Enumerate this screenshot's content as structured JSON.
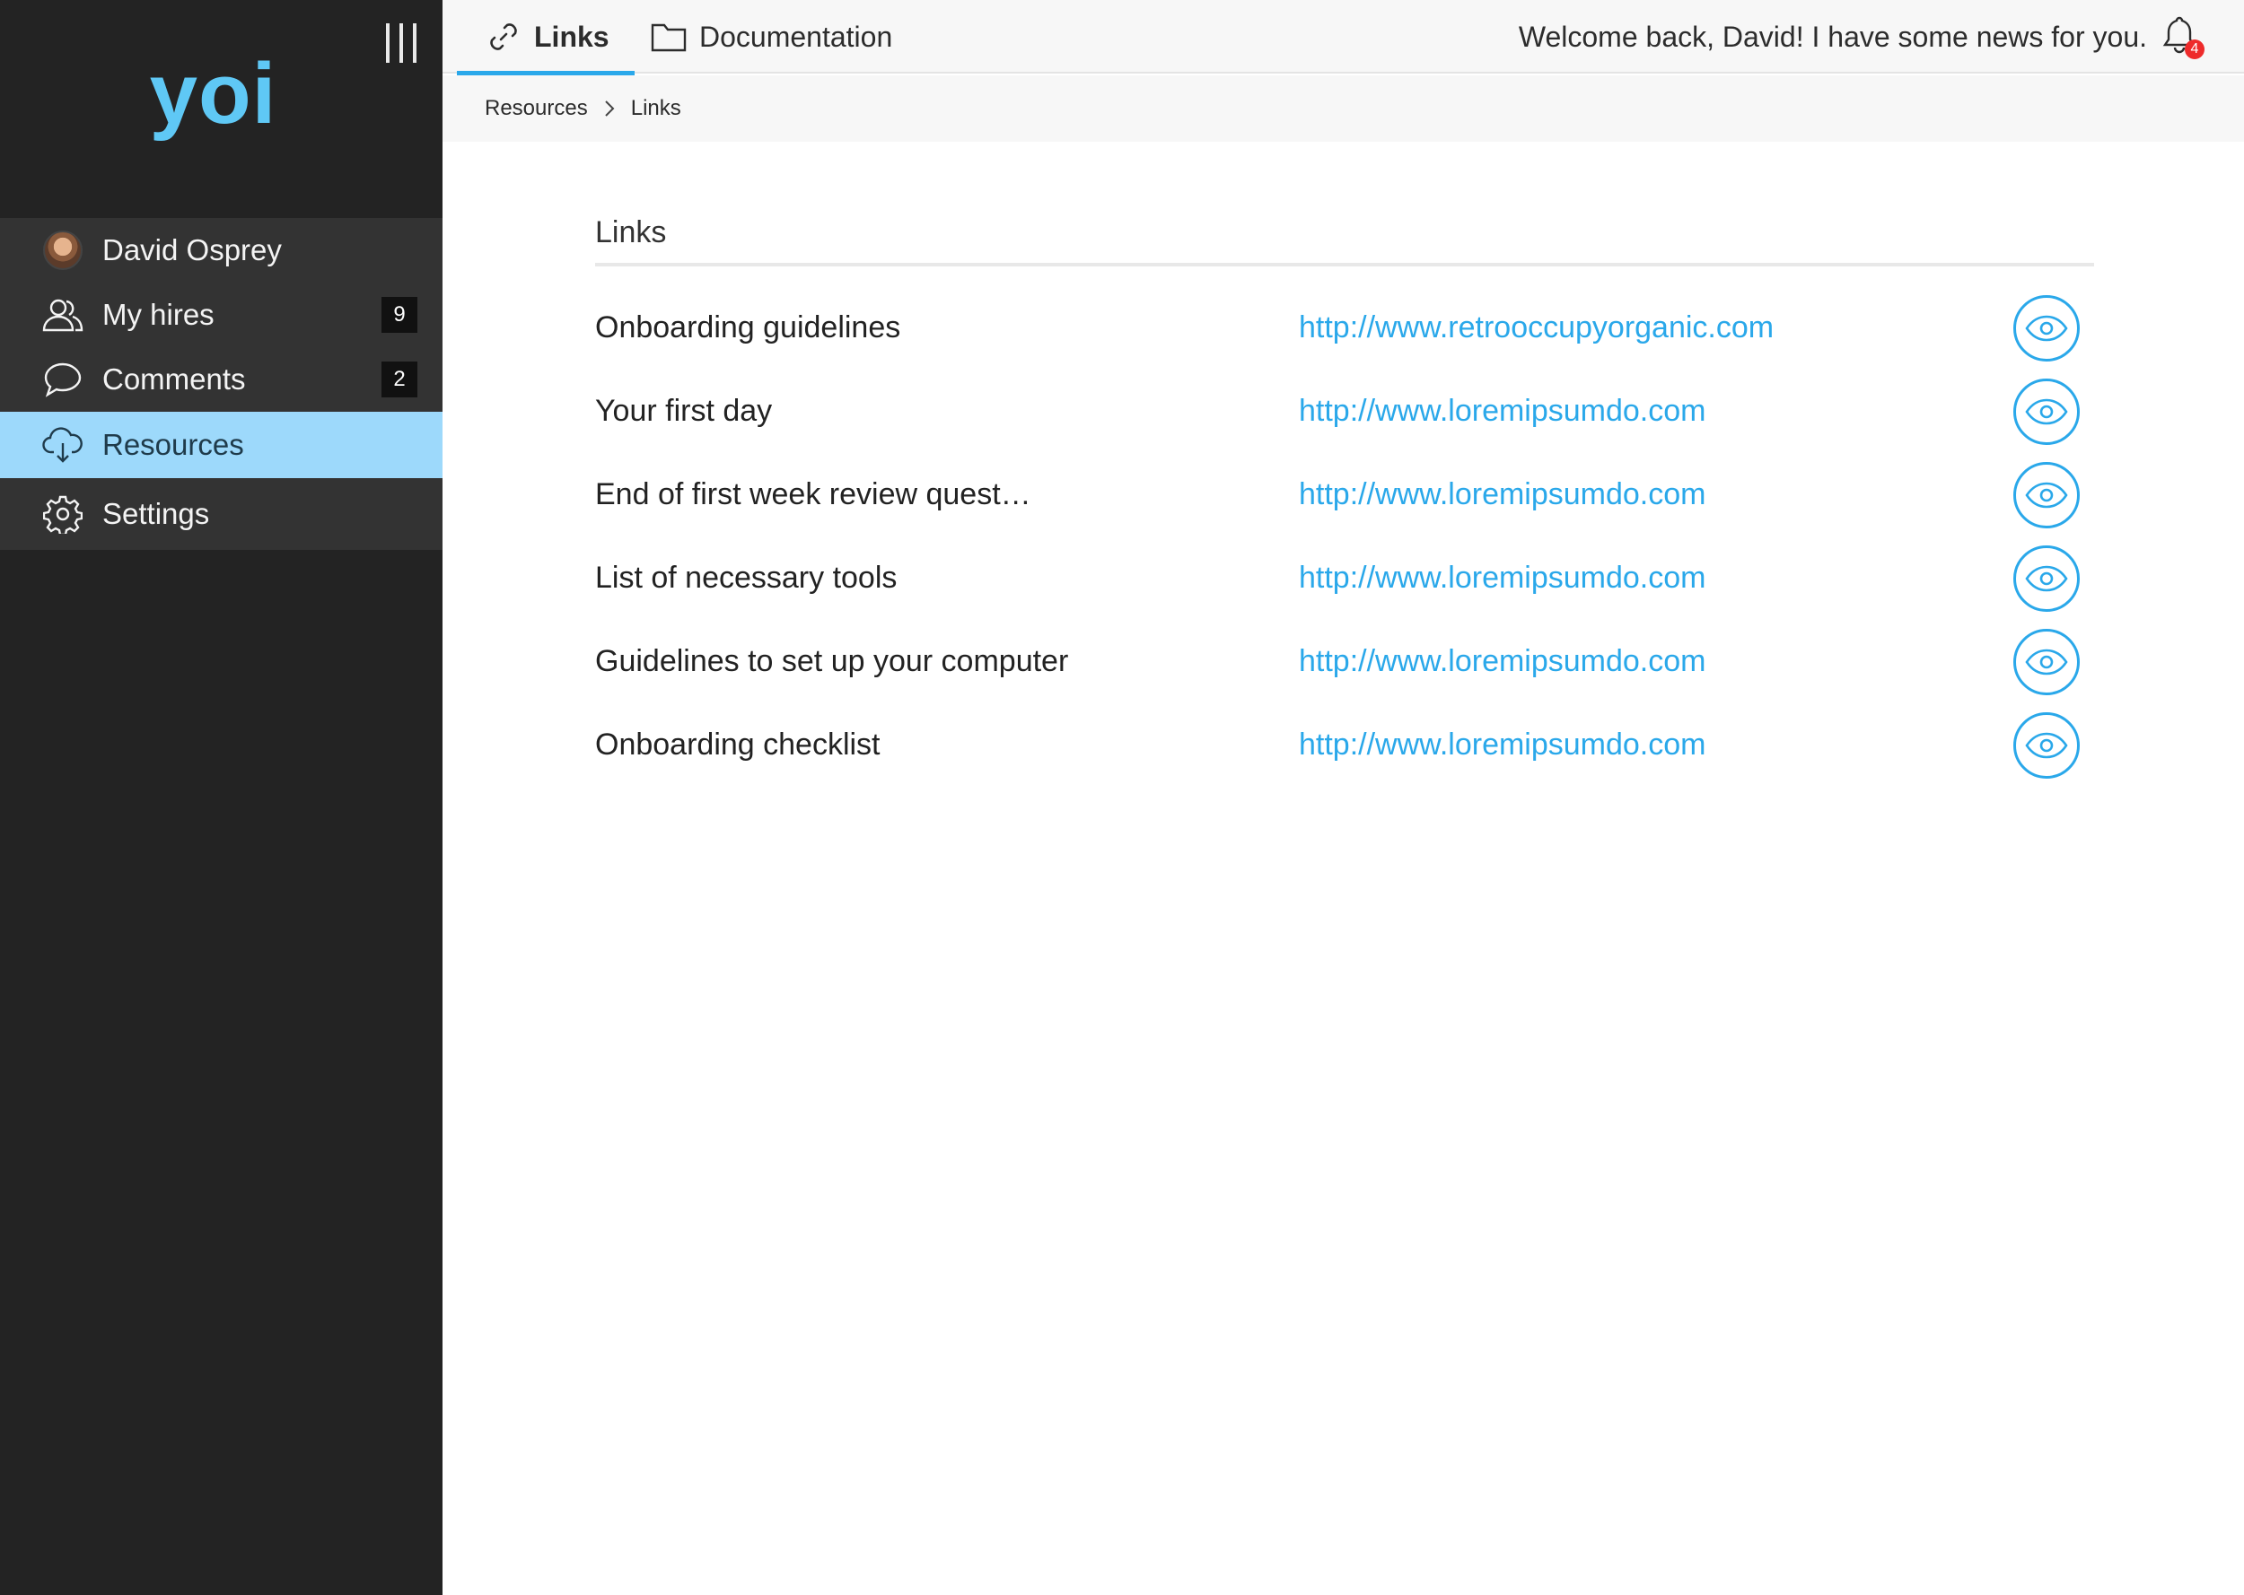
{
  "app": {
    "logo": "yoi"
  },
  "sidebar": {
    "user": {
      "name": "David Osprey"
    },
    "items": [
      {
        "label": "My hires",
        "badge": "9"
      },
      {
        "label": "Comments",
        "badge": "2"
      },
      {
        "label": "Resources"
      },
      {
        "label": "Settings"
      }
    ]
  },
  "topbar": {
    "tabs": [
      {
        "label": "Links",
        "icon": "link-icon"
      },
      {
        "label": "Documentation",
        "icon": "folder-icon"
      }
    ],
    "welcome": "Welcome back, David! I have some news for you.",
    "notification_count": "4"
  },
  "breadcrumb": {
    "items": [
      "Resources",
      "Links"
    ]
  },
  "main": {
    "section_title": "Links",
    "links": [
      {
        "title": "Onboarding guidelines",
        "url": "http://www.retrooccupyorganic.com"
      },
      {
        "title": "Your first day",
        "url": "http://www.loremipsumdo.com"
      },
      {
        "title": "End of first week review quest…",
        "url": "http://www.loremipsumdo.com"
      },
      {
        "title": "List of necessary tools",
        "url": "http://www.loremipsumdo.com"
      },
      {
        "title": "Guidelines to set up your computer",
        "url": "http://www.loremipsumdo.com"
      },
      {
        "title": "Onboarding checklist",
        "url": "http://www.loremipsumdo.com"
      }
    ]
  },
  "colors": {
    "sidebar_bg": "#232323",
    "accent": "#2aa8ea",
    "logo": "#5fc8f5",
    "active_nav": "#9dd9fb",
    "notification": "#ee2b2b"
  }
}
